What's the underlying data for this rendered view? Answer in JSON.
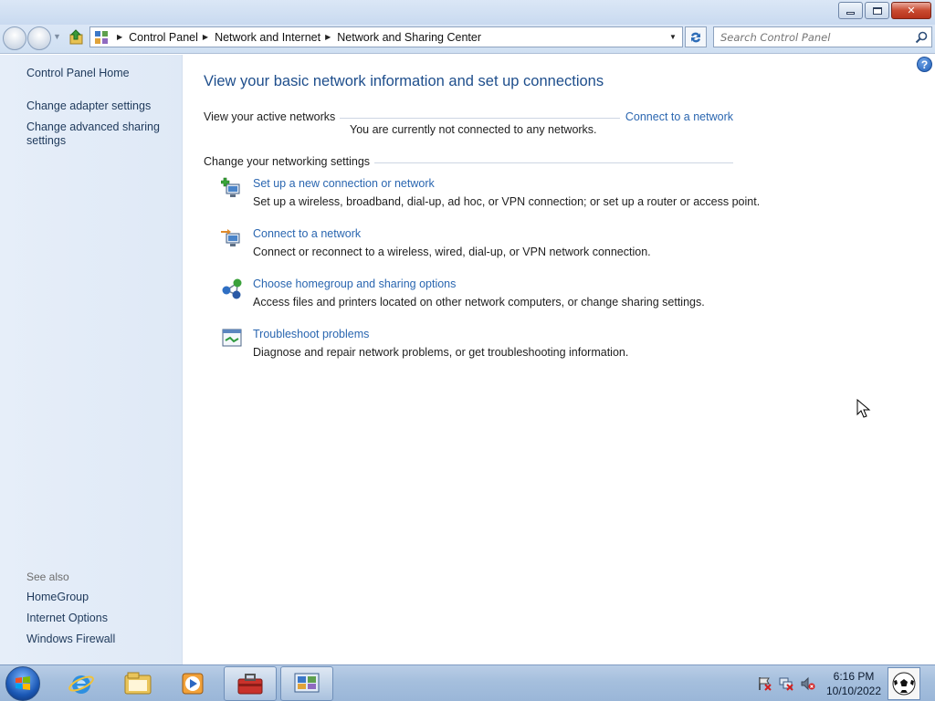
{
  "window": {
    "caption": {
      "minimize_icon": "minimize-icon",
      "maximize_icon": "restore-icon",
      "close_label": "✕"
    }
  },
  "address": {
    "breadcrumbs": [
      "Control Panel",
      "Network and Internet",
      "Network and Sharing Center"
    ],
    "search_placeholder": "Search Control Panel"
  },
  "sidebar": {
    "home": "Control Panel Home",
    "links": [
      "Change adapter settings",
      "Change advanced sharing settings"
    ],
    "see_also_label": "See also",
    "see_also": [
      "HomeGroup",
      "Internet Options",
      "Windows Firewall"
    ]
  },
  "main": {
    "title": "View your basic network information and set up connections",
    "active_networks_label": "View your active networks",
    "connect_link": "Connect to a network",
    "not_connected": "You are currently not connected to any networks.",
    "change_settings_label": "Change your networking settings",
    "tasks": [
      {
        "icon": "new-connection-icon",
        "title": "Set up a new connection or network",
        "desc": "Set up a wireless, broadband, dial-up, ad hoc, or VPN connection; or set up a router or access point."
      },
      {
        "icon": "connect-network-icon",
        "title": "Connect to a network",
        "desc": "Connect or reconnect to a wireless, wired, dial-up, or VPN network connection."
      },
      {
        "icon": "homegroup-icon",
        "title": "Choose homegroup and sharing options",
        "desc": "Access files and printers located on other network computers, or change sharing settings."
      },
      {
        "icon": "troubleshoot-icon",
        "title": "Troubleshoot problems",
        "desc": "Diagnose and repair network problems, or get troubleshooting information."
      }
    ]
  },
  "taskbar": {
    "pinned": [
      "internet-explorer-icon",
      "windows-explorer-icon",
      "media-player-icon",
      "toolbox-icon",
      "control-panel-icon"
    ],
    "tray": [
      "action-center-flag-icon",
      "network-disconnected-icon",
      "volume-muted-icon"
    ],
    "time": "6:16 PM",
    "date": "10/10/2022"
  },
  "colors": {
    "link": "#2a66b0",
    "title": "#1e4e8c",
    "nav_text": "#1e395b",
    "muted": "#6d6d6d"
  }
}
